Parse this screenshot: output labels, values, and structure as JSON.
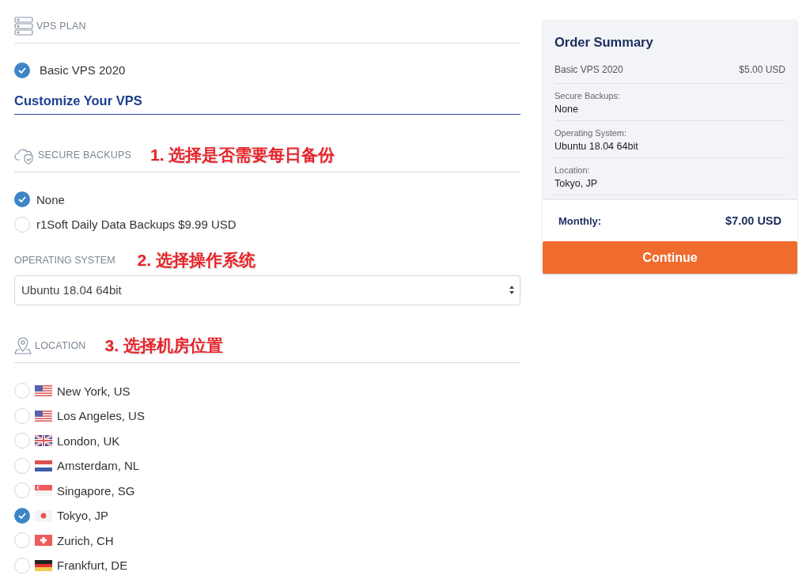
{
  "vps_plan": {
    "heading": "VPS PLAN",
    "options": [
      {
        "label": "Basic VPS 2020",
        "selected": true
      }
    ]
  },
  "customize_heading": "Customize Your VPS",
  "secure_backups": {
    "heading": "SECURE BACKUPS",
    "annotation": "1. 选择是否需要每日备份",
    "options": [
      {
        "label": "None",
        "selected": true
      },
      {
        "label": "r1Soft Daily Data Backups $9.99 USD",
        "selected": false
      }
    ]
  },
  "operating_system": {
    "heading": "OPERATING SYSTEM",
    "annotation": "2. 选择操作系统",
    "value": "Ubuntu 18.04 64bit"
  },
  "location": {
    "heading": "LOCATION",
    "annotation": "3. 选择机房位置",
    "options": [
      {
        "label": "New York, US",
        "kind": "us",
        "selected": false
      },
      {
        "label": "Los Angeles, US",
        "kind": "us",
        "selected": false
      },
      {
        "label": "London, UK",
        "kind": "uk",
        "selected": false
      },
      {
        "label": "Amsterdam, NL",
        "kind": "nl",
        "selected": false
      },
      {
        "label": "Singapore, SG",
        "kind": "sg",
        "selected": false
      },
      {
        "label": "Tokyo, JP",
        "kind": "jp",
        "selected": true
      },
      {
        "label": "Zurich, CH",
        "kind": "ch",
        "selected": false
      },
      {
        "label": "Frankfurt, DE",
        "kind": "de",
        "selected": false
      }
    ]
  },
  "order_summary": {
    "title": "Order Summary",
    "plan": {
      "name": "Basic VPS 2020",
      "price": "$5.00 USD"
    },
    "items": [
      {
        "label": "Secure Backups:",
        "value": "None"
      },
      {
        "label": "Operating System:",
        "value": "Ubuntu 18.04 64bit"
      },
      {
        "label": "Location:",
        "value": "Tokyo, JP"
      }
    ],
    "total_label": "Monthly:",
    "total": "$7.00 USD",
    "button": "Continue"
  }
}
